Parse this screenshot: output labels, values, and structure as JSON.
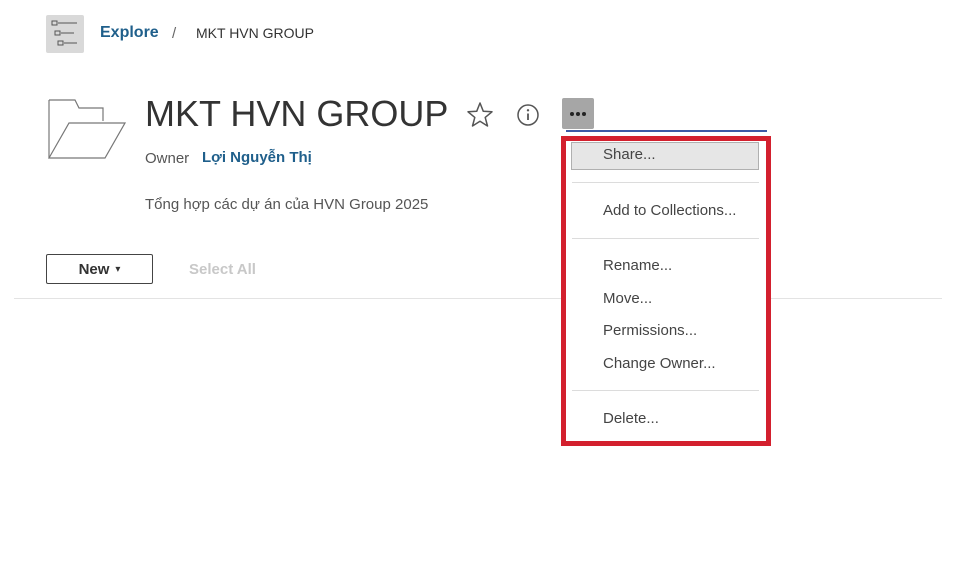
{
  "breadcrumb": {
    "explore_label": "Explore",
    "separator": "/",
    "current": "MKT HVN GROUP"
  },
  "project": {
    "title": "MKT HVN GROUP",
    "owner_label": "Owner",
    "owner_name": "Lợi Nguyễn Thị",
    "description": "Tổng hợp các dự án của HVN Group 2025"
  },
  "toolbar": {
    "new_label": "New",
    "new_caret": "▾",
    "select_all_label": "Select All"
  },
  "menu": {
    "items": [
      "Share...",
      "Add to Collections...",
      "Rename...",
      "Move...",
      "Permissions...",
      "Change Owner...",
      "Delete..."
    ],
    "highlight_color": "#d3202e"
  },
  "icons": {
    "explore": "explore-tree-icon",
    "folder": "folder-icon",
    "favorite": "star-icon",
    "info": "info-icon",
    "more": "more-actions-icon"
  },
  "colors": {
    "link": "#1f5f8b",
    "menu_outline": "#d3202e"
  }
}
